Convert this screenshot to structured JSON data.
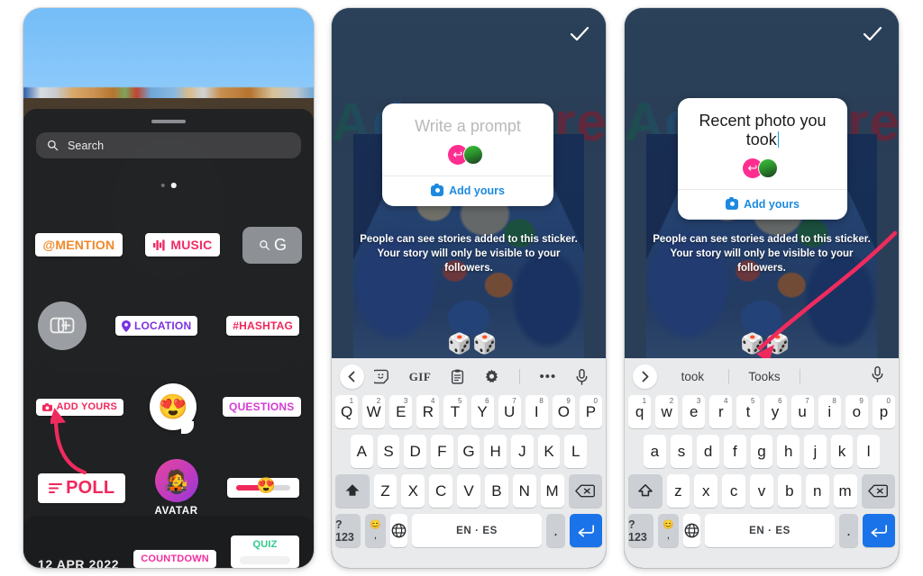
{
  "phone1": {
    "search": {
      "placeholder": "Search",
      "icon": "search-icon"
    },
    "pager": {
      "dots": 2,
      "active": 2
    },
    "stickers": {
      "mention": "@MENTION",
      "music": "MUSIC",
      "gif_search": "G",
      "add_photo": "add-photo-sticker",
      "location": "LOCATION",
      "hashtag": "#HASHTAG",
      "add_yours": "ADD YOURS",
      "emoji": "😍",
      "questions": "QUESTIONS",
      "poll": "POLL",
      "avatar_label": "AVATAR",
      "avatar_emoji": "🧑‍🎤",
      "slider_emoji": "😍",
      "countdown": "COUNTDOWN",
      "quiz": "QUIZ"
    },
    "bottom_date": "12 APR 2022"
  },
  "phone2": {
    "background_word": "Adventure",
    "sticker": {
      "prompt": "Write a prompt",
      "cta": "Add yours",
      "cta_icon": "camera-icon",
      "avatar_reply_icon": "reply-arrow-icon"
    },
    "note": "People can see stories added to this sticker. Your story will only be visible to your followers.",
    "dice": "🎲🎲",
    "done_icon": "checkmark-icon",
    "keyboard": {
      "toolbar": [
        {
          "name": "back-chevron-icon",
          "glyph": "‹"
        },
        {
          "name": "sticker-smiley-icon",
          "glyph": "sticker"
        },
        {
          "name": "gif-icon",
          "glyph": "GIF"
        },
        {
          "name": "clipboard-icon",
          "glyph": "clipboard"
        },
        {
          "name": "settings-gear-icon",
          "glyph": "gear"
        },
        {
          "name": "more-options-icon",
          "glyph": "•••"
        },
        {
          "name": "microphone-icon",
          "glyph": "mic"
        }
      ],
      "row1": [
        {
          "k": "Q",
          "n": "1"
        },
        {
          "k": "W",
          "n": "2"
        },
        {
          "k": "E",
          "n": "3"
        },
        {
          "k": "R",
          "n": "4"
        },
        {
          "k": "T",
          "n": "5"
        },
        {
          "k": "Y",
          "n": "6"
        },
        {
          "k": "U",
          "n": "7"
        },
        {
          "k": "I",
          "n": "8"
        },
        {
          "k": "O",
          "n": "9"
        },
        {
          "k": "P",
          "n": "0"
        }
      ],
      "row2": [
        "A",
        "S",
        "D",
        "F",
        "G",
        "H",
        "J",
        "K",
        "L"
      ],
      "row3": [
        "Z",
        "X",
        "C",
        "V",
        "B",
        "N",
        "M"
      ],
      "shift": "shift-filled-icon",
      "backspace": "backspace-icon",
      "numeric": "?123",
      "emoji_key": "😊",
      "comma": ",",
      "globe": "globe-icon",
      "space": "EN · ES",
      "period": ".",
      "enter": "enter-icon"
    }
  },
  "phone3": {
    "background_word": "Adventure",
    "sticker": {
      "prompt": "Recent photo you took",
      "cta": "Add yours",
      "cta_icon": "camera-icon",
      "avatar_reply_icon": "reply-arrow-icon"
    },
    "note": "People can see stories added to this sticker. Your story will only be visible to your followers.",
    "dice": "🎲🎲",
    "done_icon": "checkmark-icon",
    "keyboard": {
      "suggestions": [
        "took",
        "Tooks"
      ],
      "expand_icon": "chevron-right-icon",
      "mic_icon": "microphone-icon",
      "row1": [
        {
          "k": "q",
          "n": "1"
        },
        {
          "k": "w",
          "n": "2"
        },
        {
          "k": "e",
          "n": "3"
        },
        {
          "k": "r",
          "n": "4"
        },
        {
          "k": "t",
          "n": "5"
        },
        {
          "k": "y",
          "n": "6"
        },
        {
          "k": "u",
          "n": "7"
        },
        {
          "k": "i",
          "n": "8"
        },
        {
          "k": "o",
          "n": "9"
        },
        {
          "k": "p",
          "n": "0"
        }
      ],
      "row2": [
        "a",
        "s",
        "d",
        "f",
        "g",
        "h",
        "j",
        "k",
        "l"
      ],
      "row3": [
        "z",
        "x",
        "c",
        "v",
        "b",
        "n",
        "m"
      ],
      "shift": "shift-outline-icon",
      "backspace": "backspace-icon",
      "numeric": "?123",
      "emoji_key": "😊",
      "comma": ",",
      "globe": "globe-icon",
      "space": "EN · ES",
      "period": ".",
      "enter": "enter-icon"
    }
  },
  "annotations": {
    "arrow1": "pink-arrow-pointing-to-add-yours",
    "arrow2": "pink-arrow-pointing-to-dice"
  },
  "colors": {
    "accent_pink": "#f0285c",
    "annotation_pink": "#ef2b5e",
    "link_blue": "#1c8ae0",
    "enter_blue": "#1a73e8"
  }
}
